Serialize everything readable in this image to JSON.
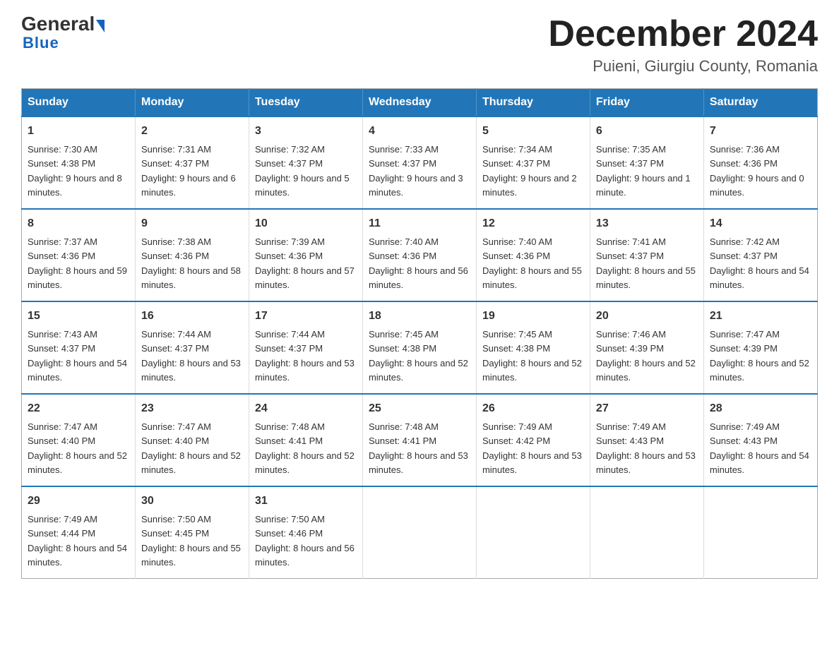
{
  "logo": {
    "general": "General",
    "triangle": "",
    "blue_line": "Blue"
  },
  "header": {
    "month_title": "December 2024",
    "location": "Puieni, Giurgiu County, Romania"
  },
  "weekdays": [
    "Sunday",
    "Monday",
    "Tuesday",
    "Wednesday",
    "Thursday",
    "Friday",
    "Saturday"
  ],
  "weeks": [
    [
      {
        "day": "1",
        "sunrise": "7:30 AM",
        "sunset": "4:38 PM",
        "daylight": "9 hours and 8 minutes."
      },
      {
        "day": "2",
        "sunrise": "7:31 AM",
        "sunset": "4:37 PM",
        "daylight": "9 hours and 6 minutes."
      },
      {
        "day": "3",
        "sunrise": "7:32 AM",
        "sunset": "4:37 PM",
        "daylight": "9 hours and 5 minutes."
      },
      {
        "day": "4",
        "sunrise": "7:33 AM",
        "sunset": "4:37 PM",
        "daylight": "9 hours and 3 minutes."
      },
      {
        "day": "5",
        "sunrise": "7:34 AM",
        "sunset": "4:37 PM",
        "daylight": "9 hours and 2 minutes."
      },
      {
        "day": "6",
        "sunrise": "7:35 AM",
        "sunset": "4:37 PM",
        "daylight": "9 hours and 1 minute."
      },
      {
        "day": "7",
        "sunrise": "7:36 AM",
        "sunset": "4:36 PM",
        "daylight": "9 hours and 0 minutes."
      }
    ],
    [
      {
        "day": "8",
        "sunrise": "7:37 AM",
        "sunset": "4:36 PM",
        "daylight": "8 hours and 59 minutes."
      },
      {
        "day": "9",
        "sunrise": "7:38 AM",
        "sunset": "4:36 PM",
        "daylight": "8 hours and 58 minutes."
      },
      {
        "day": "10",
        "sunrise": "7:39 AM",
        "sunset": "4:36 PM",
        "daylight": "8 hours and 57 minutes."
      },
      {
        "day": "11",
        "sunrise": "7:40 AM",
        "sunset": "4:36 PM",
        "daylight": "8 hours and 56 minutes."
      },
      {
        "day": "12",
        "sunrise": "7:40 AM",
        "sunset": "4:36 PM",
        "daylight": "8 hours and 55 minutes."
      },
      {
        "day": "13",
        "sunrise": "7:41 AM",
        "sunset": "4:37 PM",
        "daylight": "8 hours and 55 minutes."
      },
      {
        "day": "14",
        "sunrise": "7:42 AM",
        "sunset": "4:37 PM",
        "daylight": "8 hours and 54 minutes."
      }
    ],
    [
      {
        "day": "15",
        "sunrise": "7:43 AM",
        "sunset": "4:37 PM",
        "daylight": "8 hours and 54 minutes."
      },
      {
        "day": "16",
        "sunrise": "7:44 AM",
        "sunset": "4:37 PM",
        "daylight": "8 hours and 53 minutes."
      },
      {
        "day": "17",
        "sunrise": "7:44 AM",
        "sunset": "4:37 PM",
        "daylight": "8 hours and 53 minutes."
      },
      {
        "day": "18",
        "sunrise": "7:45 AM",
        "sunset": "4:38 PM",
        "daylight": "8 hours and 52 minutes."
      },
      {
        "day": "19",
        "sunrise": "7:45 AM",
        "sunset": "4:38 PM",
        "daylight": "8 hours and 52 minutes."
      },
      {
        "day": "20",
        "sunrise": "7:46 AM",
        "sunset": "4:39 PM",
        "daylight": "8 hours and 52 minutes."
      },
      {
        "day": "21",
        "sunrise": "7:47 AM",
        "sunset": "4:39 PM",
        "daylight": "8 hours and 52 minutes."
      }
    ],
    [
      {
        "day": "22",
        "sunrise": "7:47 AM",
        "sunset": "4:40 PM",
        "daylight": "8 hours and 52 minutes."
      },
      {
        "day": "23",
        "sunrise": "7:47 AM",
        "sunset": "4:40 PM",
        "daylight": "8 hours and 52 minutes."
      },
      {
        "day": "24",
        "sunrise": "7:48 AM",
        "sunset": "4:41 PM",
        "daylight": "8 hours and 52 minutes."
      },
      {
        "day": "25",
        "sunrise": "7:48 AM",
        "sunset": "4:41 PM",
        "daylight": "8 hours and 53 minutes."
      },
      {
        "day": "26",
        "sunrise": "7:49 AM",
        "sunset": "4:42 PM",
        "daylight": "8 hours and 53 minutes."
      },
      {
        "day": "27",
        "sunrise": "7:49 AM",
        "sunset": "4:43 PM",
        "daylight": "8 hours and 53 minutes."
      },
      {
        "day": "28",
        "sunrise": "7:49 AM",
        "sunset": "4:43 PM",
        "daylight": "8 hours and 54 minutes."
      }
    ],
    [
      {
        "day": "29",
        "sunrise": "7:49 AM",
        "sunset": "4:44 PM",
        "daylight": "8 hours and 54 minutes."
      },
      {
        "day": "30",
        "sunrise": "7:50 AM",
        "sunset": "4:45 PM",
        "daylight": "8 hours and 55 minutes."
      },
      {
        "day": "31",
        "sunrise": "7:50 AM",
        "sunset": "4:46 PM",
        "daylight": "8 hours and 56 minutes."
      },
      null,
      null,
      null,
      null
    ]
  ],
  "labels": {
    "sunrise": "Sunrise:",
    "sunset": "Sunset:",
    "daylight": "Daylight:"
  }
}
